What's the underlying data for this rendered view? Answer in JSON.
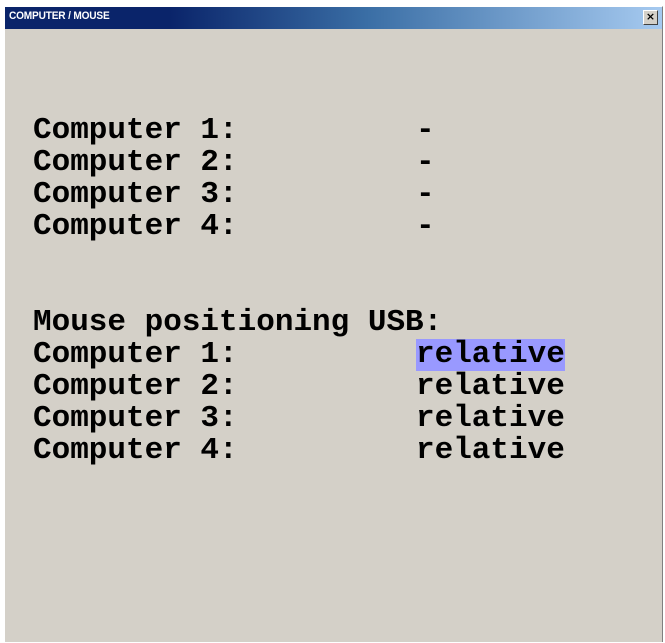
{
  "window": {
    "title": "COMPUTER / MOUSE",
    "close_glyph": "×"
  },
  "computers": [
    {
      "label": "Computer 1:",
      "value": "-"
    },
    {
      "label": "Computer 2:",
      "value": "-"
    },
    {
      "label": "Computer 3:",
      "value": "-"
    },
    {
      "label": "Computer 4:",
      "value": "-"
    }
  ],
  "mouse_positioning": {
    "heading": "Mouse positioning USB:",
    "rows": [
      {
        "label": "Computer 1:",
        "value": "relative",
        "selected": true
      },
      {
        "label": "Computer 2:",
        "value": "relative",
        "selected": false
      },
      {
        "label": "Computer 3:",
        "value": "relative",
        "selected": false
      },
      {
        "label": "Computer 4:",
        "value": "relative",
        "selected": false
      }
    ],
    "selection_color": "#9999ff"
  }
}
